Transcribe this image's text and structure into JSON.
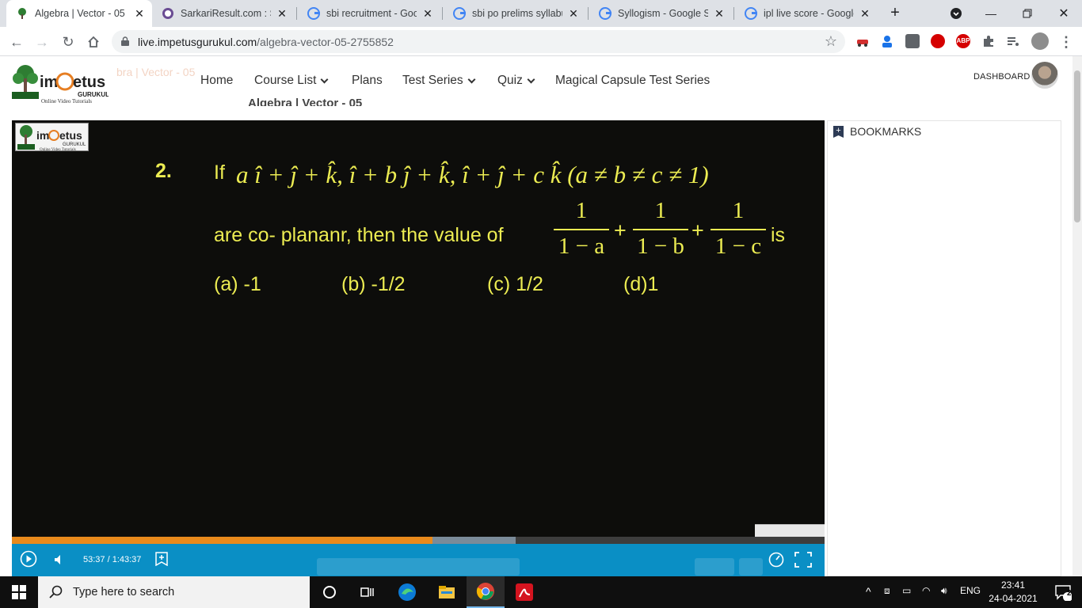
{
  "browser": {
    "tabs": [
      {
        "title": "Algebra | Vector - 05",
        "active": true
      },
      {
        "title": "SarkariResult.com : Sar",
        "active": false
      },
      {
        "title": "sbi recruitment - Goog",
        "active": false
      },
      {
        "title": "sbi po prelims syllabus",
        "active": false
      },
      {
        "title": "Syllogism - Google Sea",
        "active": false
      },
      {
        "title": "ipl live score - Google",
        "active": false
      }
    ],
    "url_host": "live.impetusgurukul.com",
    "url_path": "/algebra-vector-05-2755852",
    "extensions": [
      "abp-label"
    ],
    "abp_label": "ABP"
  },
  "site": {
    "logo": {
      "brand": "impetus",
      "sub": "GURUKUL",
      "tagline": "Online Video Tutorials"
    },
    "faded_title": "bra | Vector - 05",
    "nav": {
      "home": "Home",
      "course_list": "Course List",
      "plans": "Plans",
      "test_series": "Test Series",
      "quiz": "Quiz",
      "magical": "Magical Capsule Test Series"
    },
    "dashboard": "DASHBOARD",
    "page_title": "Algebra | Vector - 05"
  },
  "video": {
    "question_number": "2.",
    "question_if": "If",
    "vector_expr": "a î + ĵ + k̂, î + b ĵ + k̂,  î + ĵ + c k̂ (a ≠ b ≠ c ≠ 1)",
    "line2_text": "are co- plananr, then the value of",
    "fractions": [
      {
        "num": "1",
        "den": "1 − a"
      },
      {
        "num": "1",
        "den": "1 − b"
      },
      {
        "num": "1",
        "den": "1 − c"
      }
    ],
    "plus": "+",
    "is_text": "is",
    "options": [
      "(a) -1",
      "(b) -1/2",
      "(c) 1/2",
      "(d)1"
    ],
    "time": "53:37 / 1:43:37",
    "progress": 0.518,
    "buffered": 0.62,
    "colors": {
      "progress": "#e98a1c",
      "controls": "#0a8fc5",
      "text": "#ecec52"
    }
  },
  "bookmarks": {
    "title": "BOOKMARKS"
  },
  "taskbar": {
    "search_placeholder": "Type here to search",
    "lang": "ENG",
    "time": "23:41",
    "date": "24-04-2021",
    "notifications": "2"
  }
}
